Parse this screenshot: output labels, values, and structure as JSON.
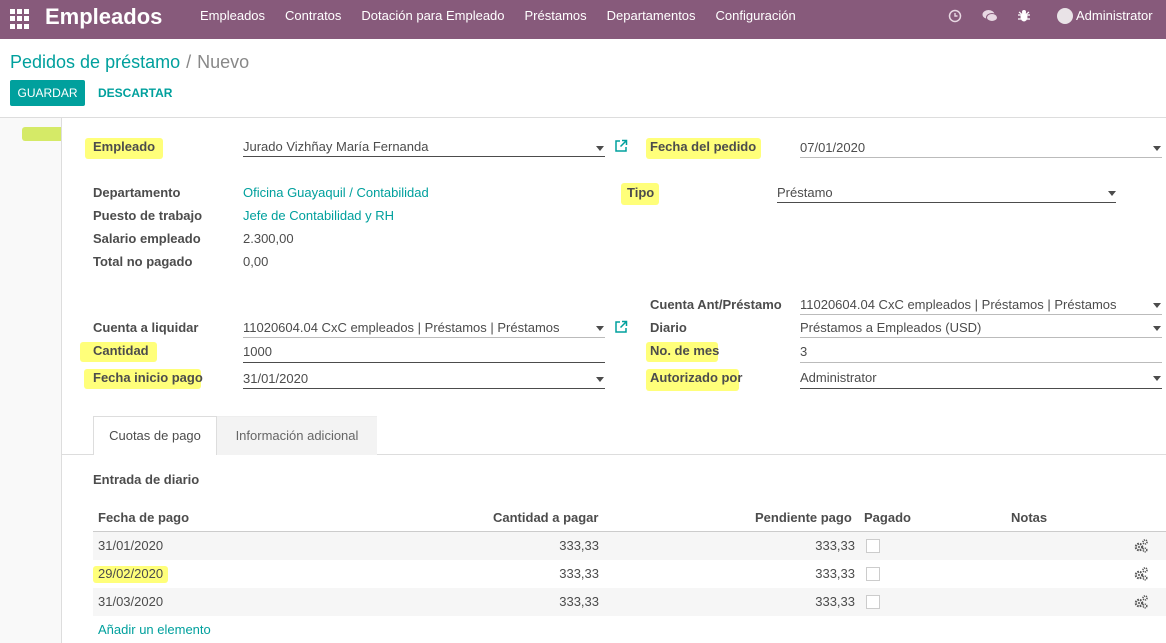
{
  "navbar": {
    "app_title": "Empleados",
    "menu": [
      "Empleados",
      "Contratos",
      "Dotación para Empleado",
      "Préstamos",
      "Departamentos",
      "Configuración"
    ],
    "user": "Administrator",
    "icons": [
      "apps-icon",
      "clock-icon",
      "chat-icon",
      "bug-icon"
    ]
  },
  "breadcrumb": {
    "parent": "Pedidos de préstamo",
    "separator": "/",
    "current": "Nuevo"
  },
  "buttons": {
    "save": "GUARDAR",
    "discard": "DESCARTAR"
  },
  "form": {
    "empleado": {
      "label": "Empleado",
      "value": "Jurado Vizhñay María Fernanda"
    },
    "fecha_pedido": {
      "label": "Fecha del pedido",
      "value": "07/01/2020"
    },
    "departamento": {
      "label": "Departamento",
      "value": "Oficina Guayaquil / Contabilidad"
    },
    "puesto": {
      "label": "Puesto de trabajo",
      "value": "Jefe de Contabilidad y RH"
    },
    "salario": {
      "label": "Salario empleado",
      "value": "2.300,00"
    },
    "total_no_pagado": {
      "label": "Total no pagado",
      "value": "0,00"
    },
    "tipo": {
      "label": "Tipo",
      "value": "Préstamo"
    },
    "cuenta_ant": {
      "label": "Cuenta Ant/Préstamo",
      "value": "11020604.04 CxC empleados | Préstamos | Préstamos"
    },
    "cuenta_liquidar": {
      "label": "Cuenta a liquidar",
      "value": "11020604.04 CxC empleados | Préstamos | Préstamos"
    },
    "diario": {
      "label": "Diario",
      "value": "Préstamos a Empleados (USD)"
    },
    "cantidad": {
      "label": "Cantidad",
      "value": "1000"
    },
    "no_mes": {
      "label": "No. de mes",
      "value": "3"
    },
    "fecha_inicio": {
      "label": "Fecha inicio pago",
      "value": "31/01/2020"
    },
    "autorizado": {
      "label": "Autorizado por",
      "value": "Administrator"
    }
  },
  "tabs": [
    "Cuotas de pago",
    "Información adicional"
  ],
  "section_title": "Entrada de diario",
  "table": {
    "headers": [
      "Fecha de pago",
      "Cantidad a pagar",
      "Pendiente pago",
      "Pagado",
      "Notas"
    ],
    "rows": [
      {
        "fecha": "31/01/2020",
        "cantidad": "333,33",
        "pendiente": "333,33"
      },
      {
        "fecha": "29/02/2020",
        "cantidad": "333,33",
        "pendiente": "333,33"
      },
      {
        "fecha": "31/03/2020",
        "cantidad": "333,33",
        "pendiente": "333,33"
      }
    ],
    "add_item": "Añadir un elemento"
  },
  "colors": {
    "navbar": "#875a7b",
    "accent": "#00a09d",
    "highlight": "#ffff55"
  }
}
